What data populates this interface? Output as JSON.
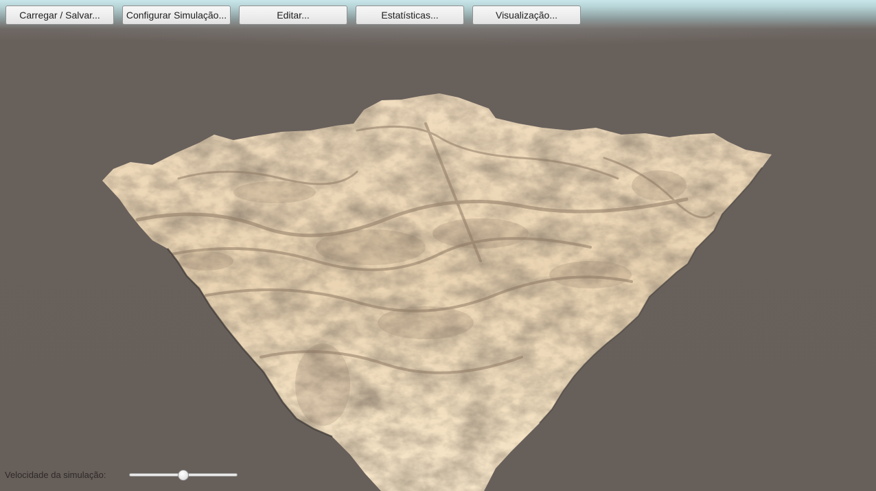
{
  "toolbar": {
    "buttons": [
      {
        "label": "Carregar / Salvar..."
      },
      {
        "label": "Configurar Simulação..."
      },
      {
        "label": "Editar..."
      },
      {
        "label": "Estatísticas..."
      },
      {
        "label": "Visualização..."
      }
    ]
  },
  "scene": {
    "background_color": "#675f5a",
    "terrain_color": "#f3dfbf",
    "terrain_shadow_color": "#8d7862"
  },
  "controls": {
    "speed_label": "Velocidade da simulação:",
    "speed_value": 0.5
  }
}
